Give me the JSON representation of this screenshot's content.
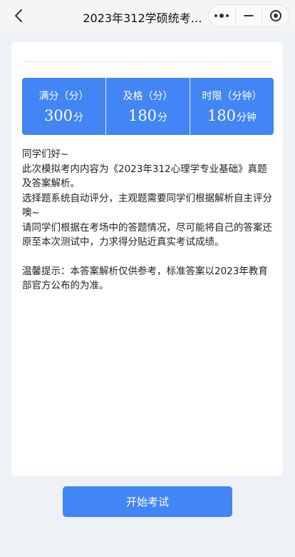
{
  "nav": {
    "title": "2023年312学硕统考…",
    "back_icon": "chevron-left-icon",
    "more_icon": "more-dots-icon",
    "minimize_icon": "minimize-icon",
    "close_icon": "target-circle-icon"
  },
  "stats": [
    {
      "label": "满分（分）",
      "value": "300",
      "unit": "分"
    },
    {
      "label": "及格（分）",
      "value": "180",
      "unit": "分"
    },
    {
      "label": "时限（分钟）",
      "value": "180",
      "unit": "分钟"
    }
  ],
  "intro": {
    "greeting": "同学们好~",
    "line1": "此次模拟考内内容为《2023年312心理学专业基础》真题及答案解析。",
    "line2": "选择题系统自动评分，主观题需要同学们根据解析自主评分噢~",
    "line3": "请同学们根据在考场中的答题情况，尽可能将自己的答案还原至本次测试中，力求得分贴近真实考试成绩。",
    "tip": "温馨提示：本答案解析仅供参考，标准答案以2023年教育部官方公布的为准。"
  },
  "start_button": "开始考试",
  "colors": {
    "accent": "#4285f4",
    "background": "#eef2f7"
  }
}
